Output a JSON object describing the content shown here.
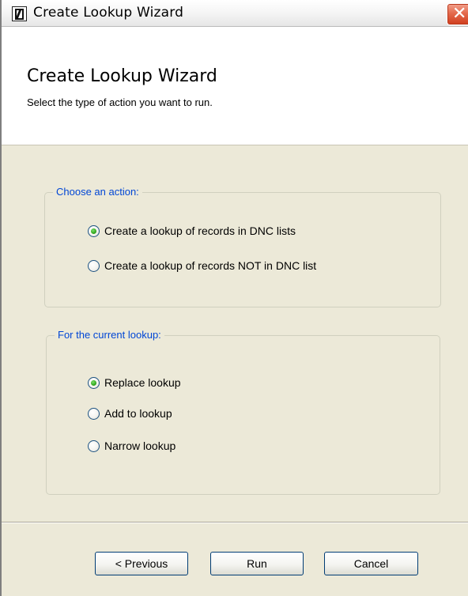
{
  "window": {
    "title": "Create Lookup Wizard",
    "close_glyph": "✕"
  },
  "header": {
    "title": "Create Lookup Wizard",
    "subtitle": "Select the type of action you want to run."
  },
  "action_group": {
    "legend": "Choose an action:",
    "options": [
      {
        "label": "Create a lookup of records in DNC lists",
        "checked": true
      },
      {
        "label": "Create a lookup of records NOT in DNC list",
        "checked": false
      }
    ]
  },
  "lookup_group": {
    "legend": "For the current lookup:",
    "options": [
      {
        "label": "Replace lookup",
        "checked": true
      },
      {
        "label": "Add to lookup",
        "checked": false
      },
      {
        "label": "Narrow lookup",
        "checked": false
      }
    ]
  },
  "buttons": {
    "previous": "< Previous",
    "run": "Run",
    "cancel": "Cancel"
  },
  "colors": {
    "legend_text": "#0046d5",
    "dialog_bg": "#ece9d8",
    "radio_checked": "#32a71d",
    "close_button": "#e46a4d"
  }
}
